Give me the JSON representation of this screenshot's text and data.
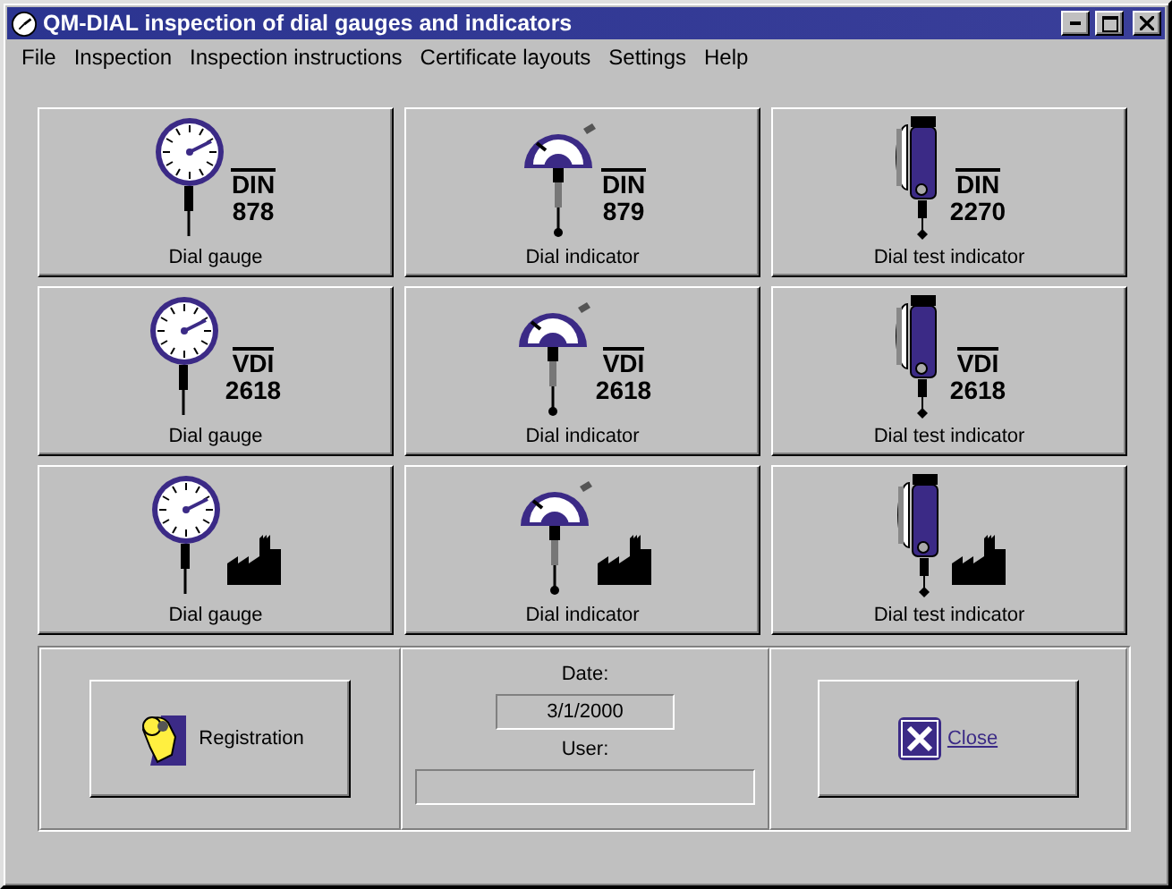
{
  "window": {
    "title": "QM-DIAL inspection of dial gauges and indicators"
  },
  "menu": [
    "File",
    "Inspection",
    "Inspection instructions",
    "Certificate layouts",
    "Settings",
    "Help"
  ],
  "tiles": [
    {
      "kind": "gauge",
      "badge": {
        "kind": "standard",
        "name": "DIN",
        "number": "878"
      },
      "label": "Dial gauge"
    },
    {
      "kind": "indicator",
      "badge": {
        "kind": "standard",
        "name": "DIN",
        "number": "879"
      },
      "label": "Dial indicator"
    },
    {
      "kind": "test",
      "badge": {
        "kind": "standard",
        "name": "DIN",
        "number": "2270"
      },
      "label": "Dial test indicator"
    },
    {
      "kind": "gauge",
      "badge": {
        "kind": "standard",
        "name": "VDI",
        "number": "2618"
      },
      "label": "Dial gauge"
    },
    {
      "kind": "indicator",
      "badge": {
        "kind": "standard",
        "name": "VDI",
        "number": "2618"
      },
      "label": "Dial indicator"
    },
    {
      "kind": "test",
      "badge": {
        "kind": "standard",
        "name": "VDI",
        "number": "2618"
      },
      "label": "Dial test indicator"
    },
    {
      "kind": "gauge",
      "badge": {
        "kind": "factory"
      },
      "label": "Dial gauge"
    },
    {
      "kind": "indicator",
      "badge": {
        "kind": "factory"
      },
      "label": "Dial indicator"
    },
    {
      "kind": "test",
      "badge": {
        "kind": "factory"
      },
      "label": "Dial test indicator"
    }
  ],
  "registration_button": {
    "label": "Registration"
  },
  "date": {
    "label": "Date:",
    "value": "3/1/2000"
  },
  "user": {
    "label": "User:"
  },
  "close_button": {
    "label": "Close"
  }
}
